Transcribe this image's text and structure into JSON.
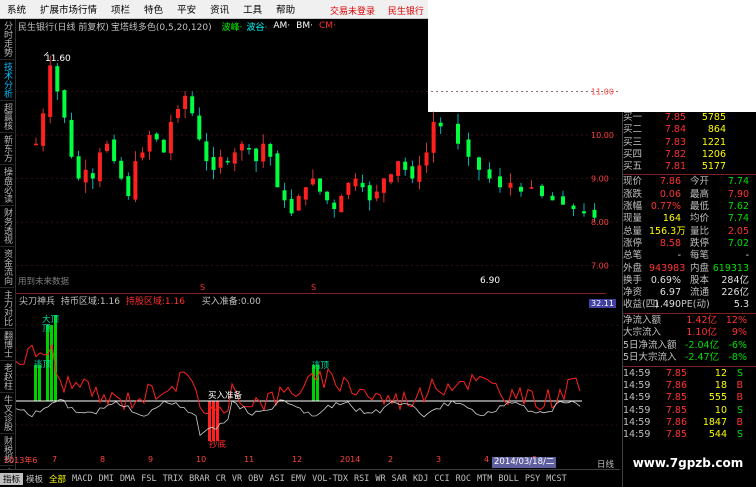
{
  "menu": [
    "系统",
    "扩展市场行情",
    "项栏",
    "特色",
    "平安",
    "资讯",
    "工具",
    "帮助"
  ],
  "top_links": [
    "交易未登录",
    "民生银行"
  ],
  "left_tabs": [
    "分时走势",
    "技术分析",
    "超赢核",
    "新东方",
    "操盘必读",
    "财务透视",
    "资金流向",
    "主力对比",
    "翻博士",
    "老赵柱",
    "牛叉诊股",
    "财税视",
    "痕迹"
  ],
  "left_active": 1,
  "main_header": {
    "stock": "民生银行(日线 前复权)",
    "indicator": "宝塔线多色(0,5,20,120)",
    "bolang": "波峰·",
    "bogu": "波谷·",
    "am": "AM·",
    "bm": "BM·",
    "cm": "CM·"
  },
  "main_labels": {
    "high": "11.60",
    "low": "6.90",
    "note": "用到未来数据",
    "s_marks": [
      "S",
      "S"
    ]
  },
  "axis_labels": [
    "11.00",
    "10.00",
    "9.00",
    "8.00",
    "7.00"
  ],
  "sub_header": {
    "name": "尖刀神兵",
    "a": "持币区域:1.16",
    "b": "持股区域:1.16",
    "c": "买入准备:0.00"
  },
  "sub_labels": {
    "dading": "大顶",
    "dingbu": "顶",
    "zhengding": "逃顶",
    "mairu": "买入准备",
    "dadi": "抄底",
    "dingbu2": "逃顶"
  },
  "sub_axis_top": "32.11",
  "time_axis": [
    "2013年6",
    "7",
    "8",
    "9",
    "10",
    "11",
    "12",
    "2014",
    "2",
    "3",
    "4",
    "5"
  ],
  "date_box": "2014/03/18/二",
  "day_flag": "日线",
  "bottom_tabs": [
    "指标",
    "模板",
    "全部",
    "MACD",
    "DMI",
    "DMA",
    "FSL",
    "TRIX",
    "BRAR",
    "CR",
    "VR",
    "OBV",
    "ASI",
    "EMV",
    "VOL-TDX",
    "RSI",
    "WR",
    "SAR",
    "KDJ",
    "CCI",
    "ROC",
    "MTM",
    "BOLL",
    "PSY",
    "MCST"
  ],
  "order_book": [
    {
      "label": "买一",
      "price": "7.85",
      "vol": "5785"
    },
    {
      "label": "买二",
      "price": "7.84",
      "vol": "864"
    },
    {
      "label": "买三",
      "price": "7.83",
      "vol": "1221"
    },
    {
      "label": "买四",
      "price": "7.82",
      "vol": "1206"
    },
    {
      "label": "买五",
      "price": "7.81",
      "vol": "5177"
    }
  ],
  "quote": [
    {
      "a": "现价",
      "b": "7.86",
      "bc": "red",
      "d": "今开",
      "e": "7.74",
      "ec": "green"
    },
    {
      "a": "涨跌",
      "b": "0.06",
      "bc": "red",
      "d": "最高",
      "e": "7.90",
      "ec": "red"
    },
    {
      "a": "涨幅",
      "b": "0.77%",
      "bc": "red",
      "d": "最低",
      "e": "7.62",
      "ec": "green"
    },
    {
      "a": "现量",
      "b": "164",
      "bc": "yel",
      "d": "均价",
      "e": "7.74",
      "ec": "green"
    },
    {
      "a": "总量",
      "b": "156.3万",
      "bc": "yel",
      "d": "量比",
      "e": "2.05",
      "ec": "red"
    },
    {
      "a": "涨停",
      "b": "8.58",
      "bc": "red",
      "d": "跌停",
      "e": "7.02",
      "ec": "green"
    },
    {
      "a": "总笔",
      "b": "-",
      "bc": "wht",
      "d": "每笔",
      "e": "-",
      "ec": "wht"
    },
    {
      "a": "外盘",
      "b": "943983",
      "bc": "red",
      "d": "内盘",
      "e": "619313",
      "ec": "green"
    },
    {
      "a": "换手",
      "b": "0.69%",
      "bc": "wht",
      "d": "股本",
      "e": "284亿",
      "ec": "wht"
    },
    {
      "a": "净资",
      "b": "6.97",
      "bc": "wht",
      "d": "流通",
      "e": "226亿",
      "ec": "wht"
    },
    {
      "a": "收益(四)",
      "b": "1.490",
      "bc": "wht",
      "d": "PE(动)",
      "e": "5.3",
      "ec": "wht"
    }
  ],
  "flows": [
    {
      "a": "净流入额",
      "b": "1.42亿",
      "bc": "red",
      "e": "12%",
      "ec": "red"
    },
    {
      "a": "大宗流入",
      "b": "1.10亿",
      "bc": "red",
      "e": "9%",
      "ec": "red"
    },
    {
      "a": "5日净流入额",
      "b": "-2.04亿",
      "bc": "green",
      "e": "-6%",
      "ec": "green"
    },
    {
      "a": "5日大宗流入",
      "b": "-2.47亿",
      "bc": "green",
      "e": "-8%",
      "ec": "green"
    }
  ],
  "ticks": [
    {
      "t": "14:59",
      "p": "7.85",
      "v": "12",
      "s": "S",
      "sc": "green"
    },
    {
      "t": "14:59",
      "p": "7.86",
      "v": "18",
      "s": "B",
      "sc": "red"
    },
    {
      "t": "14:59",
      "p": "7.85",
      "v": "555",
      "s": "B",
      "sc": "red"
    },
    {
      "t": "14:59",
      "p": "7.85",
      "v": "10",
      "s": "S",
      "sc": "green"
    },
    {
      "t": "14:59",
      "p": "7.86",
      "v": "1847",
      "s": "B",
      "sc": "red"
    },
    {
      "t": "14:59",
      "p": "7.85",
      "v": "544",
      "s": "S",
      "sc": "green"
    }
  ],
  "watermark": "www.7gpzb.com",
  "chart_data": {
    "type": "candlestick",
    "title": "民生银行(日线 前复权)",
    "ylim": [
      6.6,
      12.0
    ],
    "close_series_approx": [
      9.8,
      10.5,
      11.6,
      11.0,
      10.4,
      9.5,
      9.0,
      9.2,
      9.0,
      9.6,
      9.8,
      9.4,
      9.0,
      8.6,
      9.4,
      9.6,
      10.0,
      9.9,
      9.6,
      10.3,
      10.6,
      10.9,
      10.5,
      9.9,
      9.4,
      9.2,
      9.5,
      9.4,
      9.6,
      9.8,
      9.7,
      9.4,
      9.8,
      9.5,
      8.8,
      8.5,
      8.2,
      8.6,
      8.8,
      9.0,
      8.7,
      8.5,
      8.3,
      8.6,
      8.9,
      9.0,
      8.8,
      8.5,
      8.7,
      9.0,
      9.1,
      9.4,
      9.2,
      9.0,
      9.3,
      9.6,
      10.3,
      10.2,
      9.8,
      9.5,
      9.2,
      9.0,
      8.8,
      8.9,
      8.7,
      8.8,
      8.6,
      8.5,
      8.4,
      8.3,
      8.2,
      8.1
    ]
  }
}
